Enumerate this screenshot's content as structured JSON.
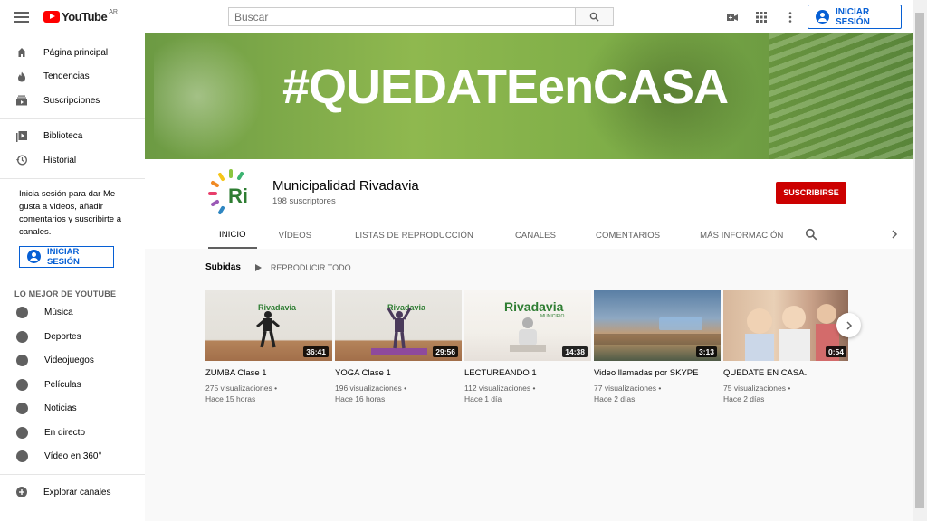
{
  "topbar": {
    "logo_text": "YouTube",
    "country": "AR",
    "search_placeholder": "Buscar",
    "signin_label": "INICIAR SESIÓN"
  },
  "sidebar": {
    "primary": [
      {
        "label": "Página principal",
        "icon": "home-icon"
      },
      {
        "label": "Tendencias",
        "icon": "trending-icon"
      },
      {
        "label": "Suscripciones",
        "icon": "subscriptions-icon"
      }
    ],
    "library": [
      {
        "label": "Biblioteca",
        "icon": "library-icon"
      },
      {
        "label": "Historial",
        "icon": "history-icon"
      }
    ],
    "signin_note": "Inicia sesión para dar Me gusta a videos, añadir comentarios y suscribirte a canales.",
    "signin_label": "INICIAR SESIÓN",
    "best_heading": "LO MEJOR DE YOUTUBE",
    "best": [
      {
        "label": "Música",
        "icon": "music-icon"
      },
      {
        "label": "Deportes",
        "icon": "sports-icon"
      },
      {
        "label": "Videojuegos",
        "icon": "gaming-icon"
      },
      {
        "label": "Películas",
        "icon": "movies-icon"
      },
      {
        "label": "Noticias",
        "icon": "news-icon"
      },
      {
        "label": "En directo",
        "icon": "live-icon"
      },
      {
        "label": "Vídeo en 360°",
        "icon": "360-icon"
      }
    ],
    "explore": {
      "label": "Explorar canales",
      "icon": "add-circle-icon"
    }
  },
  "banner": {
    "text": "#QUEDATEenCASA"
  },
  "channel": {
    "name": "Municipalidad Rivadavia",
    "subscribers": "198 suscriptores",
    "avatar_text": "Ri",
    "subscribe_label": "SUSCRIBIRSE",
    "tabs": [
      "INICIO",
      "VÍDEOS",
      "LISTAS DE REPRODUCCIÓN",
      "CANALES",
      "COMENTARIOS",
      "MÁS INFORMACIÓN"
    ]
  },
  "section": {
    "title": "Subidas",
    "play_all": "REPRODUCIR TODO"
  },
  "videos": [
    {
      "title": "ZUMBA Clase 1",
      "views": "275 visualizaciones",
      "age": "Hace 15 horas",
      "duration": "36:41",
      "thumb_brand": "Rivadavia"
    },
    {
      "title": "YOGA Clase 1",
      "views": "196 visualizaciones",
      "age": "Hace 16 horas",
      "duration": "29:56",
      "thumb_brand": "Rivadavia"
    },
    {
      "title": "LECTUREANDO 1",
      "views": "112 visualizaciones",
      "age": "Hace 1 día",
      "duration": "14:38",
      "thumb_brand": "Rivadavia",
      "thumb_sub": "MUNICIPIO"
    },
    {
      "title": "Video llamadas por SKYPE",
      "views": "77 visualizaciones",
      "age": "Hace 2 días",
      "duration": "3:13"
    },
    {
      "title": "QUEDATE EN CASA.",
      "views": "75 visualizaciones",
      "age": "Hace 2 días",
      "duration": "0:54"
    }
  ],
  "colors": {
    "accent": "#065fd4",
    "subscribe": "#cc0000",
    "brand_red": "#ff0000",
    "banner_green": "#7fae48"
  }
}
